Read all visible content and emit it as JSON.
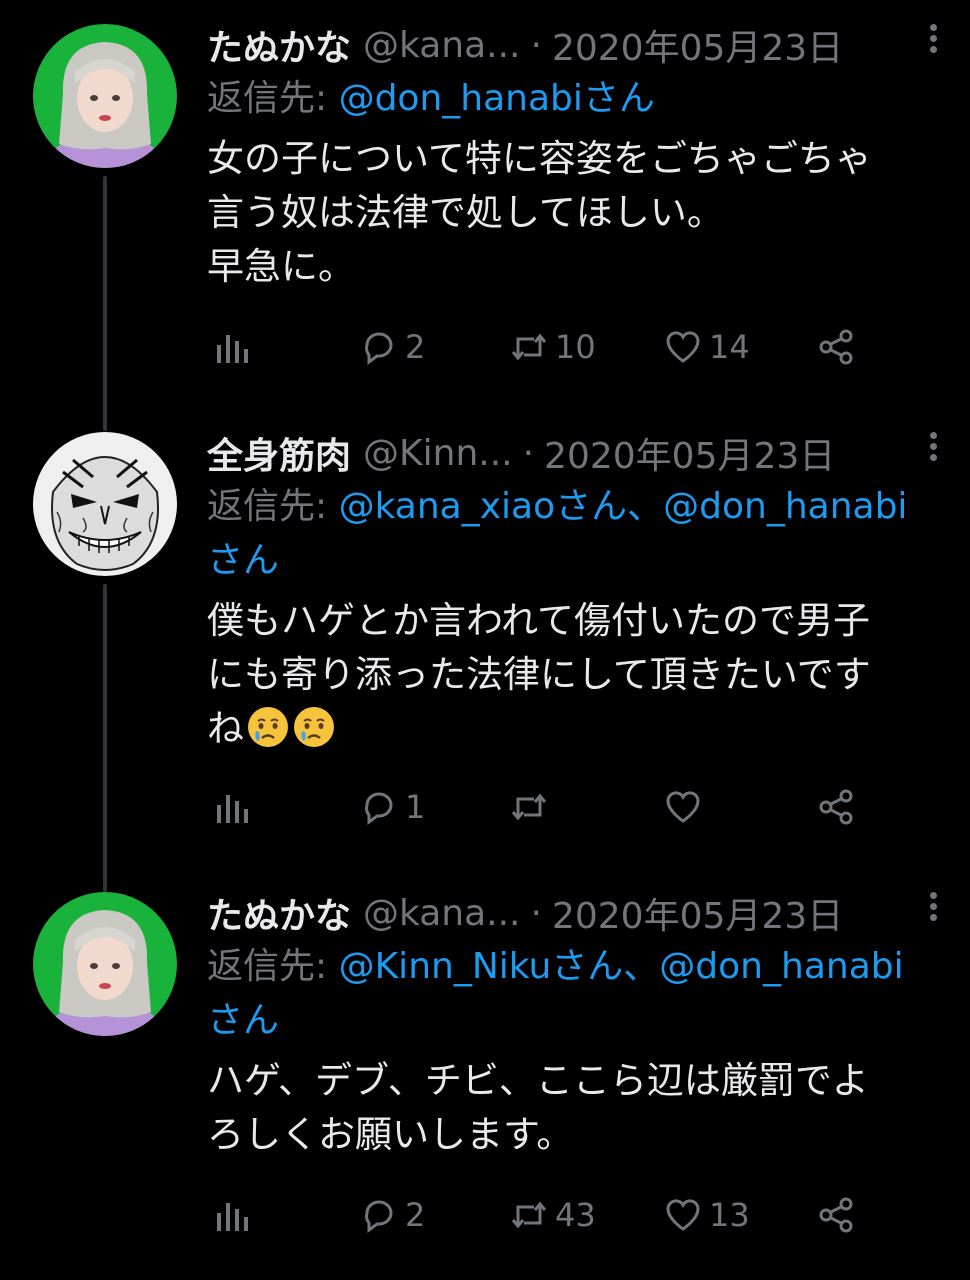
{
  "tweets": [
    {
      "name": "たぬかな",
      "handle": "@kana...",
      "date": "2020年05月23日",
      "reply_prefix": "返信先: ",
      "mentions": "@don_hanabiさん",
      "mentions_line2": "",
      "text": "女の子について特に容姿をごちゃごちゃ\n言う奴は法律で処してほしい。\n早急に。",
      "replies": "2",
      "retweets": "10",
      "likes": "14",
      "avatar_icon": "girl-avatar"
    },
    {
      "name": "全身筋肉",
      "handle": "@Kinn...",
      "date": "2020年05月23日",
      "reply_prefix": "返信先: ",
      "mentions": "@kana_xiaoさん、@don_hanabi",
      "mentions_line2": "さん",
      "text": "僕もハゲとか言われて傷付いたので男子\nにも寄り添った法律にして頂きたいです\nね",
      "emoji": "crying-face-emoji",
      "replies": "1",
      "retweets": "",
      "likes": "",
      "avatar_icon": "manga-face-avatar"
    },
    {
      "name": "たぬかな",
      "handle": "@kana...",
      "date": "2020年05月23日",
      "reply_prefix": "返信先: ",
      "mentions": "@Kinn_Nikuさん、@don_hanabi",
      "mentions_line2": "さん",
      "text": "ハゲ、デブ、チビ、ここら辺は厳罰でよ\nろしくお願いします。",
      "replies": "2",
      "retweets": "43",
      "likes": "13",
      "avatar_icon": "girl-avatar"
    }
  ],
  "colors": {
    "background": "#000000",
    "text": "#e7e9ea",
    "muted": "#71767b",
    "link": "#1d9bf0",
    "thread_line": "#333639"
  }
}
